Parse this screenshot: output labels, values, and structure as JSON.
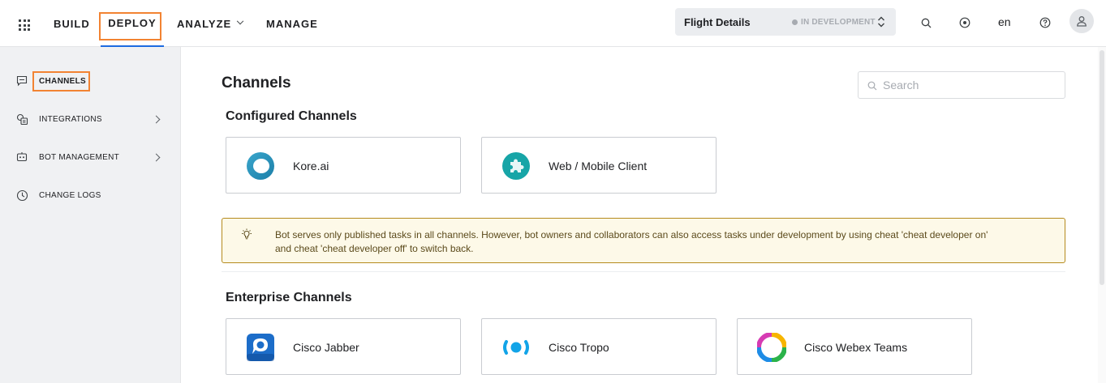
{
  "topbar": {
    "apps_icon": "apps-grid-icon",
    "nav": [
      {
        "label": "BUILD"
      },
      {
        "label": "DEPLOY",
        "active": true
      },
      {
        "label": "ANALYZE"
      },
      {
        "label": "MANAGE"
      }
    ],
    "bot": {
      "name": "Flight Details",
      "status": "IN DEVELOPMENT"
    },
    "language": "en",
    "icons": [
      "search-icon",
      "notification-icon",
      "help-icon",
      "user-avatar-icon"
    ]
  },
  "sidebar": {
    "items": [
      {
        "label": "CHANNELS",
        "icon": "chat-icon",
        "active": true
      },
      {
        "label": "INTEGRATIONS",
        "icon": "integrations-icon"
      },
      {
        "label": "BOT MANAGEMENT",
        "icon": "bot-icon"
      },
      {
        "label": "CHANGE LOGS",
        "icon": "history-icon"
      }
    ]
  },
  "main": {
    "title": "Channels",
    "search": {
      "placeholder": "Search",
      "value": ""
    },
    "configured": {
      "title": "Configured Channels",
      "channels": [
        {
          "label": "Kore.ai",
          "icon": "koreai-logo-icon"
        },
        {
          "label": "Web / Mobile Client",
          "icon": "puzzle-icon"
        }
      ]
    },
    "info": "Bot serves only published tasks in all channels. However, bot owners and collaborators can also access tasks under development by using cheat 'cheat developer on' and cheat 'cheat developer off' to switch back.",
    "enterprise": {
      "title": "Enterprise Channels",
      "channels": [
        {
          "label": "Cisco Jabber",
          "icon": "cisco-jabber-icon"
        },
        {
          "label": "Cisco Tropo",
          "icon": "cisco-tropo-icon"
        },
        {
          "label": "Cisco Webex Teams",
          "icon": "webex-teams-icon"
        }
      ]
    }
  },
  "colors": {
    "accent": "#1d6be0",
    "highlight": "#f28332",
    "banner_bg": "#fdf9e8",
    "banner_border": "#b58a1d"
  }
}
